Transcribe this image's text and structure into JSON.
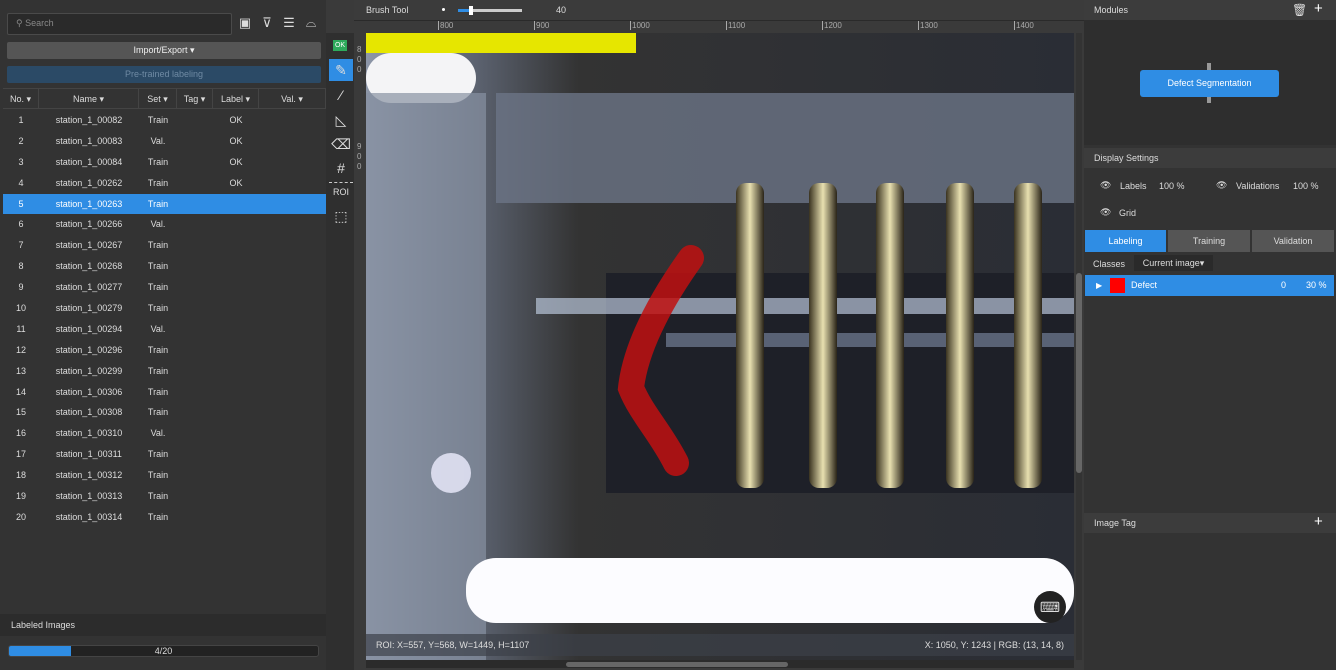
{
  "left_panel": {
    "search_placeholder": "Search",
    "icons": [
      "image-settings-icon",
      "filter-icon",
      "list-icon",
      "split-view-icon"
    ],
    "import_export": "Import/Export ▾",
    "pretrained": "Pre-trained labeling",
    "columns": [
      "No.",
      "Name",
      "Set",
      "Tag",
      "Label",
      "Val."
    ],
    "rows": [
      [
        "1",
        "station_1_00082",
        "Train",
        "",
        "OK",
        ""
      ],
      [
        "2",
        "station_1_00083",
        "Val.",
        "",
        "OK",
        ""
      ],
      [
        "3",
        "station_1_00084",
        "Train",
        "",
        "OK",
        ""
      ],
      [
        "4",
        "station_1_00262",
        "Train",
        "",
        "OK",
        ""
      ],
      [
        "5",
        "station_1_00263",
        "Train",
        "",
        "",
        ""
      ],
      [
        "6",
        "station_1_00266",
        "Val.",
        "",
        "",
        ""
      ],
      [
        "7",
        "station_1_00267",
        "Train",
        "",
        "",
        ""
      ],
      [
        "8",
        "station_1_00268",
        "Train",
        "",
        "",
        ""
      ],
      [
        "9",
        "station_1_00277",
        "Train",
        "",
        "",
        ""
      ],
      [
        "10",
        "station_1_00279",
        "Train",
        "",
        "",
        ""
      ],
      [
        "11",
        "station_1_00294",
        "Val.",
        "",
        "",
        ""
      ],
      [
        "12",
        "station_1_00296",
        "Train",
        "",
        "",
        ""
      ],
      [
        "13",
        "station_1_00299",
        "Train",
        "",
        "",
        ""
      ],
      [
        "14",
        "station_1_00306",
        "Train",
        "",
        "",
        ""
      ],
      [
        "15",
        "station_1_00308",
        "Train",
        "",
        "",
        ""
      ],
      [
        "16",
        "station_1_00310",
        "Val.",
        "",
        "",
        ""
      ],
      [
        "17",
        "station_1_00311",
        "Train",
        "",
        "",
        ""
      ],
      [
        "18",
        "station_1_00312",
        "Train",
        "",
        "",
        ""
      ],
      [
        "19",
        "station_1_00313",
        "Train",
        "",
        "",
        ""
      ],
      [
        "20",
        "station_1_00314",
        "Train",
        "",
        "",
        ""
      ]
    ],
    "selected_row": 5,
    "labeled_images_title": "Labeled Images",
    "labeled_progress": "4/20",
    "labeled_fraction": 0.2
  },
  "tools": {
    "ok_badge": "OK",
    "roi": "ROI",
    "items": [
      "brush-icon",
      "magic-wand-icon",
      "polygon-icon",
      "eraser-icon",
      "grid-icon",
      "roi-icon",
      "select-region-icon"
    ]
  },
  "toolbar": {
    "tool_name": "Brush Tool",
    "brush_size": "40",
    "brush_fraction": 0.2
  },
  "ruler": {
    "top": [
      "800",
      "900",
      "1000",
      "1100",
      "1200",
      "1300",
      "1400"
    ],
    "left": [
      "800",
      "900"
    ]
  },
  "viewer": {
    "roi_text": "ROI: X=557, Y=568, W=1449, H=1107",
    "cursor_text": "X: 1050, Y: 1243 | RGB: (13, 14, 8)"
  },
  "right_panel": {
    "modules_title": "Modules",
    "module_node": "Defect Segmentation",
    "display_settings": "Display Settings",
    "labels": "Labels",
    "labels_pct": "100 %",
    "validations": "Validations",
    "validations_pct": "100 %",
    "grid": "Grid",
    "tabs": [
      "Labeling",
      "Training",
      "Validation"
    ],
    "active_tab": "Labeling",
    "classes": "Classes",
    "class_filter": "Current image▾",
    "class_items": [
      {
        "name": "Defect",
        "color": "#ff0000",
        "count": "0",
        "opacity": "30 %"
      }
    ],
    "image_tag": "Image Tag"
  },
  "colors": {
    "accent": "#2f8de4",
    "ok": "#2eaa5c"
  }
}
